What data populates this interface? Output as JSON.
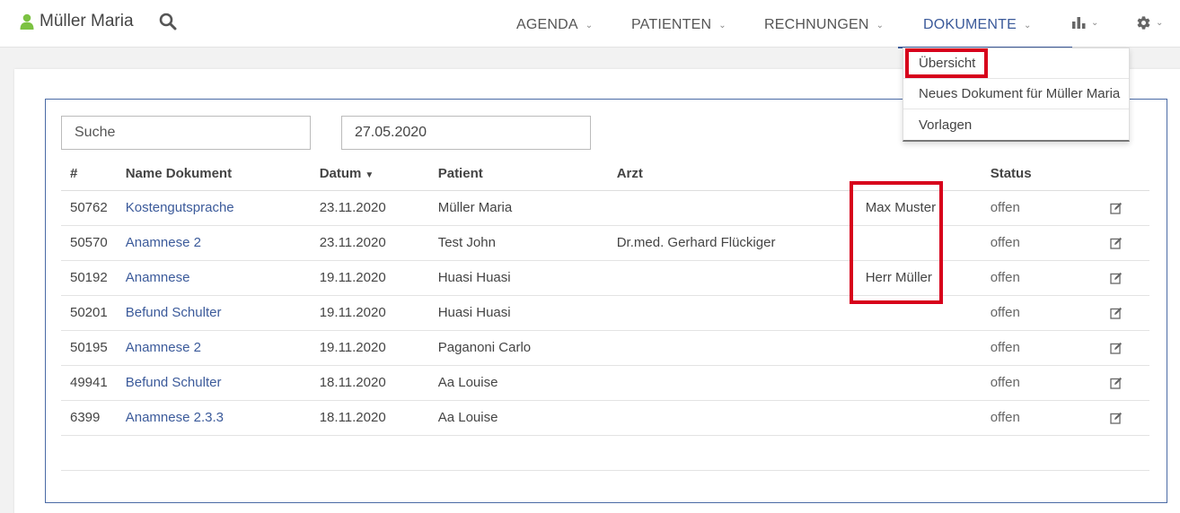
{
  "header": {
    "user_name": "Müller Maria",
    "nav": [
      {
        "label": "AGENDA"
      },
      {
        "label": "PATIENTEN"
      },
      {
        "label": "RECHNUNGEN"
      },
      {
        "label": "DOKUMENTE"
      }
    ],
    "active_nav": "DOKUMENTE"
  },
  "dropdown": {
    "items": [
      "Übersicht",
      "Neues Dokument für Müller Maria",
      "Vorlagen"
    ]
  },
  "filters": {
    "search_placeholder": "Suche",
    "date_value": "27.05.2020"
  },
  "table": {
    "columns": [
      "#",
      "Name Dokument",
      "Datum",
      "Patient",
      "Arzt",
      "",
      "Status"
    ],
    "sorted_column": "Datum",
    "rows": [
      {
        "id": "50762",
        "name": "Kostengutsprache",
        "date": "23.11.2020",
        "patient": "Müller Maria",
        "arzt": "",
        "extra": "Max Muster",
        "status": "offen"
      },
      {
        "id": "50570",
        "name": "Anamnese 2",
        "date": "23.11.2020",
        "patient": "Test John",
        "arzt": "Dr.med. Gerhard Flückiger",
        "extra": "",
        "status": "offen"
      },
      {
        "id": "50192",
        "name": "Anamnese",
        "date": "19.11.2020",
        "patient": "Huasi Huasi",
        "arzt": "",
        "extra": "Herr Müller",
        "status": "offen"
      },
      {
        "id": "50201",
        "name": "Befund Schulter",
        "date": "19.11.2020",
        "patient": "Huasi Huasi",
        "arzt": "",
        "extra": "",
        "status": "offen"
      },
      {
        "id": "50195",
        "name": "Anamnese 2",
        "date": "19.11.2020",
        "patient": "Paganoni Carlo",
        "arzt": "",
        "extra": "",
        "status": "offen"
      },
      {
        "id": "49941",
        "name": "Befund Schulter",
        "date": "18.11.2020",
        "patient": "Aa Louise",
        "arzt": "",
        "extra": "",
        "status": "offen"
      },
      {
        "id": "6399",
        "name": "Anamnese 2.3.3",
        "date": "18.11.2020",
        "patient": "Aa Louise",
        "arzt": "",
        "extra": "",
        "status": "offen"
      }
    ]
  },
  "colors": {
    "accent": "#3b5a9a",
    "user_icon": "#7cc242",
    "highlight": "#d7001b"
  },
  "icons": {
    "user": "user-icon",
    "search": "search-icon",
    "chart": "bar-chart-icon",
    "settings": "gear-icon",
    "edit": "edit-icon",
    "chevron": "chevron-down-icon"
  }
}
